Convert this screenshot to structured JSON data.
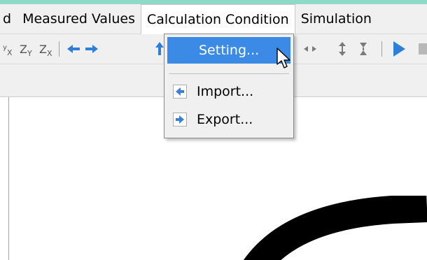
{
  "menubar": {
    "items": [
      "d",
      "Measured Values",
      "Calculation Condition",
      "Simulation"
    ]
  },
  "dropdown": {
    "items": [
      {
        "label": "Setting...",
        "highlighted": true
      },
      {
        "label": "Import...",
        "icon": "import-icon"
      },
      {
        "label": "Export...",
        "icon": "export-icon"
      }
    ]
  },
  "colors": {
    "menu_highlight": "#3b8be6",
    "toolbar_arrow": "#2f7fd8",
    "play": "#2f7fd8",
    "top_strip": "#8fd9c8"
  }
}
